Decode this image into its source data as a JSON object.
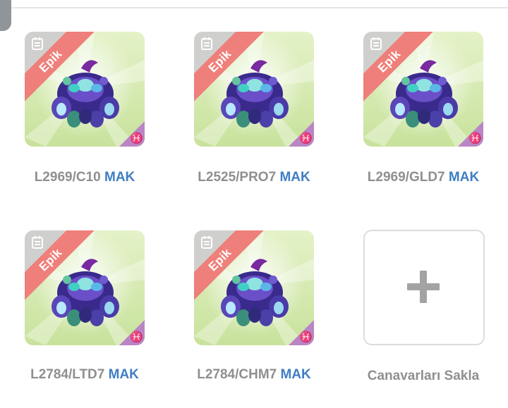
{
  "monsters": [
    {
      "rarity": "Epik",
      "code": "L2969/C10",
      "tag": "MAK",
      "icon": "document-icon",
      "element_icon": "pisces-icon",
      "element_glyph": "♓"
    },
    {
      "rarity": "Epik",
      "code": "L2525/PRO7",
      "tag": "MAK",
      "icon": "document-icon",
      "element_icon": "pisces-icon",
      "element_glyph": "♓"
    },
    {
      "rarity": "Epik",
      "code": "L2969/GLD7",
      "tag": "MAK",
      "icon": "document-icon",
      "element_icon": "pisces-icon",
      "element_glyph": "♓"
    },
    {
      "rarity": "Epik",
      "code": "L2784/LTD7",
      "tag": "MAK",
      "icon": "document-icon",
      "element_icon": "pisces-icon",
      "element_glyph": "♓"
    },
    {
      "rarity": "Epik",
      "code": "L2784/CHM7",
      "tag": "MAK",
      "icon": "document-icon",
      "element_icon": "pisces-icon",
      "element_glyph": "♓"
    }
  ],
  "store_slot": {
    "label": "Canavarları Sakla",
    "icon": "plus-icon"
  },
  "colors": {
    "ribbon": "#ef7f7a",
    "tag": "#3f7ec4",
    "label": "#8f8f8f",
    "badge": "#b985c4",
    "card_bg": "#c8e29c"
  }
}
